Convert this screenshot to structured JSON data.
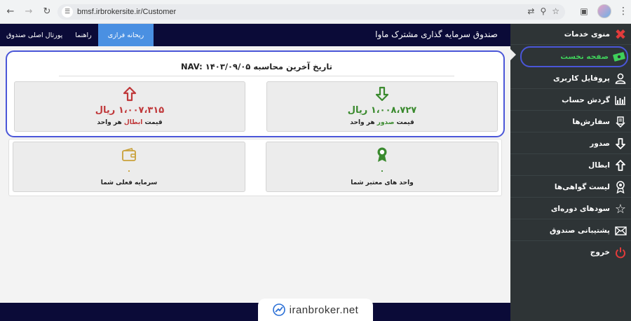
{
  "browser": {
    "url": "bmsf.irbrokersite.ir/Customer",
    "icons": [
      "back-icon",
      "forward-icon",
      "reload-icon",
      "site-settings-icon",
      "translate-icon",
      "zoom-icon",
      "bookmark-star-icon",
      "extensions-icon",
      "profile-avatar",
      "menu-dots-icon"
    ]
  },
  "header": {
    "title": "صندوق سرمایه گذاری مشترک ماوا",
    "links": [
      {
        "label": "ریحانه فرازی",
        "active": true
      },
      {
        "label": "راهنما",
        "active": false
      },
      {
        "label": "پورتال اصلی صندوق",
        "active": false
      }
    ]
  },
  "sidebar": {
    "items": [
      {
        "label": "منوی خدمات",
        "icon": "close-x-icon"
      },
      {
        "label": "صفحه نخست",
        "icon": "money-icon",
        "active": true
      },
      {
        "label": "پروفایل کاربری",
        "icon": "user-icon"
      },
      {
        "label": "گردش حساب",
        "icon": "bar-chart-icon"
      },
      {
        "label": "سفارش‌ها",
        "icon": "orders-icon"
      },
      {
        "label": "صدور",
        "icon": "arrow-down-icon"
      },
      {
        "label": "ابطال",
        "icon": "arrow-up-icon"
      },
      {
        "label": "لیست گواهی‌ها",
        "icon": "certificate-icon"
      },
      {
        "label": "سودهای دوره‌ای",
        "icon": "star-icon"
      },
      {
        "label": "پشتیبانی صندوق",
        "icon": "mail-icon"
      },
      {
        "label": "خروج",
        "icon": "power-icon"
      }
    ]
  },
  "nav": {
    "title": "تاریخ آخرین محاسبه NAV: ۱۴۰۳/۰۹/۰۵",
    "issue": {
      "value": "۱،۰۰۸،۷۲۷ ریال",
      "label_prefix": "قیمت",
      "label_highlight": "صدور",
      "label_suffix": "هر واحد",
      "color": "#3a8a2e"
    },
    "redeem": {
      "value": "۱،۰۰۷،۳۱۵ ریال",
      "label_prefix": "قیمت",
      "label_highlight": "ابطال",
      "label_suffix": "هر واحد",
      "color": "#c0393b"
    }
  },
  "summary": {
    "units": {
      "value": "۰",
      "label": "واحد های معتبر شما"
    },
    "capital": {
      "value": "۰",
      "label": "سرمایه فعلی شما"
    }
  },
  "watermark": {
    "text": "iranbroker.net"
  }
}
